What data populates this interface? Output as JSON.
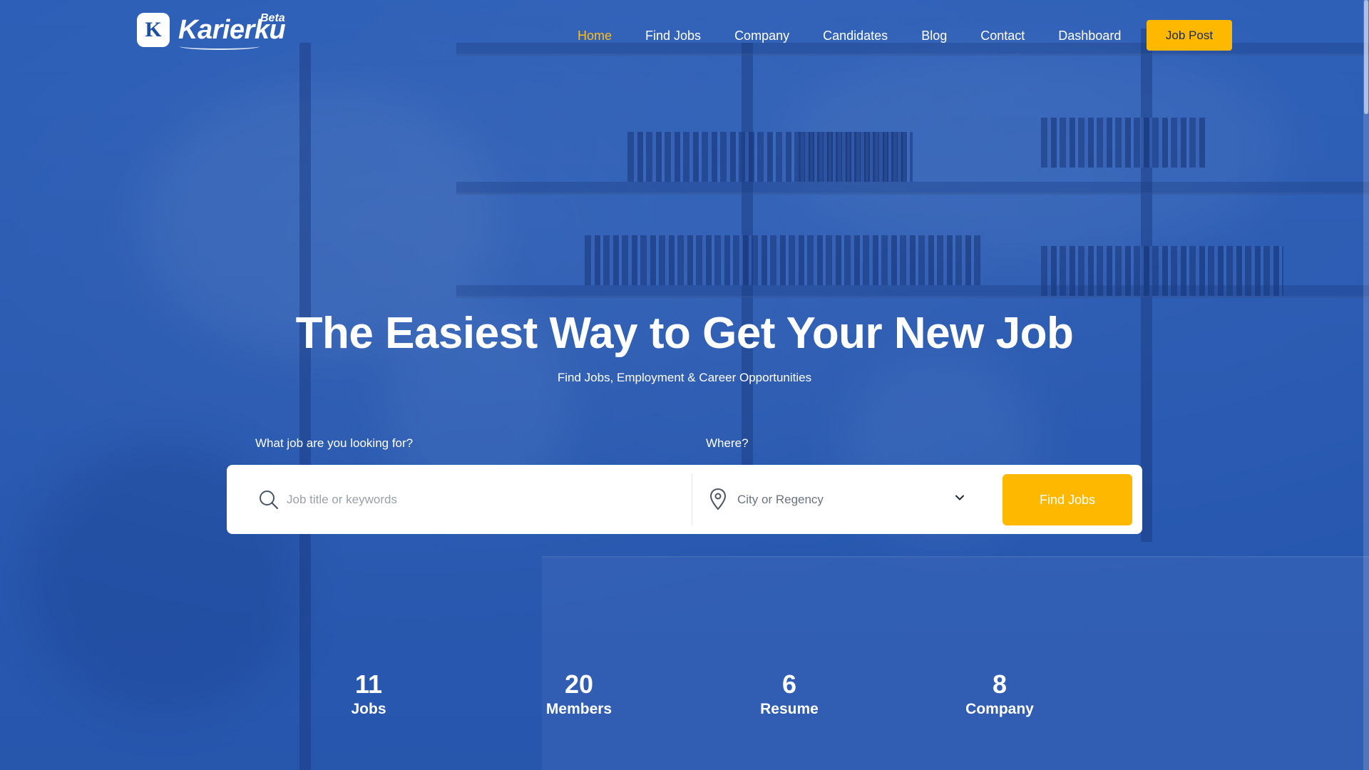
{
  "brand": {
    "logo_letter": "K",
    "name": "Karierku",
    "badge": "Beta"
  },
  "nav": {
    "items": [
      {
        "label": "Home",
        "active": true
      },
      {
        "label": "Find Jobs"
      },
      {
        "label": "Company"
      },
      {
        "label": "Candidates"
      },
      {
        "label": "Blog"
      },
      {
        "label": "Contact"
      },
      {
        "label": "Dashboard"
      }
    ],
    "cta_label": "Job Post"
  },
  "hero": {
    "title": "The Easiest Way to Get Your New Job",
    "subtitle": "Find Jobs, Employment & Career Opportunities"
  },
  "search": {
    "what_label": "What job are you looking for?",
    "where_label": "Where?",
    "keyword_placeholder": "Job title or keywords",
    "keyword_value": "",
    "location_selected": "City or Regency",
    "submit_label": "Find Jobs"
  },
  "stats": [
    {
      "number": "11",
      "label": "Jobs"
    },
    {
      "number": "20",
      "label": "Members"
    },
    {
      "number": "6",
      "label": "Resume"
    },
    {
      "number": "8",
      "label": "Company"
    }
  ],
  "colors": {
    "accent": "#ffb800",
    "nav_active": "#ffbf1f",
    "hero_overlay": "#2f62b8"
  },
  "icons": [
    "search-icon",
    "map-pin-icon",
    "chevron-down-icon"
  ]
}
